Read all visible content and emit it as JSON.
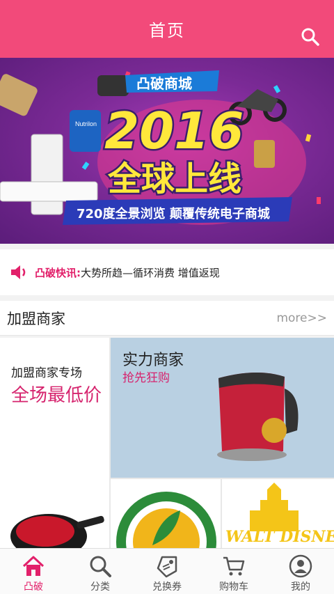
{
  "header": {
    "title": "首页"
  },
  "banner": {
    "brand": "凸破商城",
    "year": "2016",
    "headline": "全球上线",
    "tagline": "720度全景浏览  颠覆传统电子商城",
    "product_label": "Nutrilon"
  },
  "notice": {
    "label": "凸破快讯:",
    "text": "大势所趋—循环消费 增值返现"
  },
  "merchants": {
    "title": "加盟商家",
    "more": "more>>",
    "left": {
      "subtitle": "加盟商家专场",
      "headline": "全场最低价"
    },
    "top_right": {
      "title": "实力商家",
      "subtitle": "抢先狂购"
    },
    "logo_disney": "WALT DISNEY"
  },
  "nav": {
    "items": [
      {
        "label": "凸破",
        "icon": "home-icon",
        "active": true
      },
      {
        "label": "分类",
        "icon": "search-icon",
        "active": false
      },
      {
        "label": "兑换券",
        "icon": "coupon-icon",
        "active": false
      },
      {
        "label": "购物车",
        "icon": "cart-icon",
        "active": false
      },
      {
        "label": "我的",
        "icon": "user-icon",
        "active": false
      }
    ]
  },
  "colors": {
    "accent": "#f24a7a",
    "highlight": "#d6246e"
  }
}
